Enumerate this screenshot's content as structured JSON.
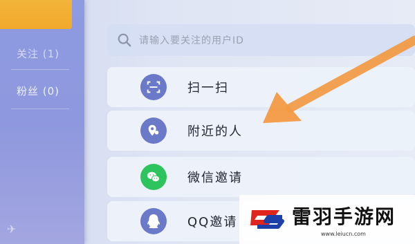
{
  "sidebar": {
    "top_tab": "",
    "items": [
      {
        "label": "关注 (1)"
      },
      {
        "label": "粉丝 (0)"
      }
    ]
  },
  "search": {
    "placeholder": "请输入要关注的用户ID",
    "icon": "search-icon"
  },
  "list": [
    {
      "label": "扫一扫",
      "icon": "scan-icon"
    },
    {
      "label": "附近的人",
      "icon": "location-pin-icon"
    },
    {
      "label": "微信邀请",
      "icon": "wechat-icon"
    },
    {
      "label": "QQ邀请",
      "icon": "qq-icon"
    }
  ],
  "watermark": {
    "brand": "雷羽手游网",
    "url": "www.leiucn.com"
  },
  "colors": {
    "accent": "#f39a43",
    "sidebar": "#8e9be0",
    "tab": "#f1a92b",
    "wechat": "#2ec45d",
    "icon_bg": "#6a79c8"
  }
}
